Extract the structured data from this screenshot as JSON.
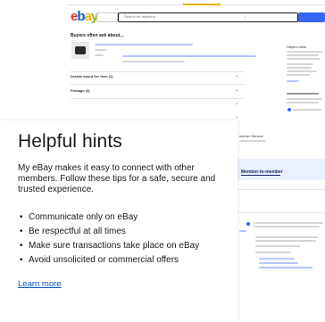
{
  "header": {
    "logo": [
      "e",
      "b",
      "a",
      "y"
    ],
    "search_placeholder": "Search for anything"
  },
  "main": {
    "buyers_ask_title": "Buyers often ask about...",
    "sections": [
      {
        "label": "Details about the item (1)"
      },
      {
        "label": "Postage (3)"
      }
    ]
  },
  "sidebar": {
    "title": "Helpful hints",
    "customer_service_label": "stomer Service"
  },
  "member_banner": {
    "label": "Member-to-member"
  },
  "hints_card": {
    "title": "Helpful hints",
    "intro": "My eBay makes it easy to connect with other members. Follow these tips for a safe, secure and trusted experience.",
    "tips": [
      "Communicate only on eBay",
      "Be respectful at all times",
      "Make sure transactions take place on eBay",
      "Avoid unsolicited or commercial offers"
    ],
    "learn_more": "Learn more"
  },
  "colors": {
    "primary_blue": "#3665f3",
    "link_blue": "#0654ba",
    "text": "#191919"
  }
}
